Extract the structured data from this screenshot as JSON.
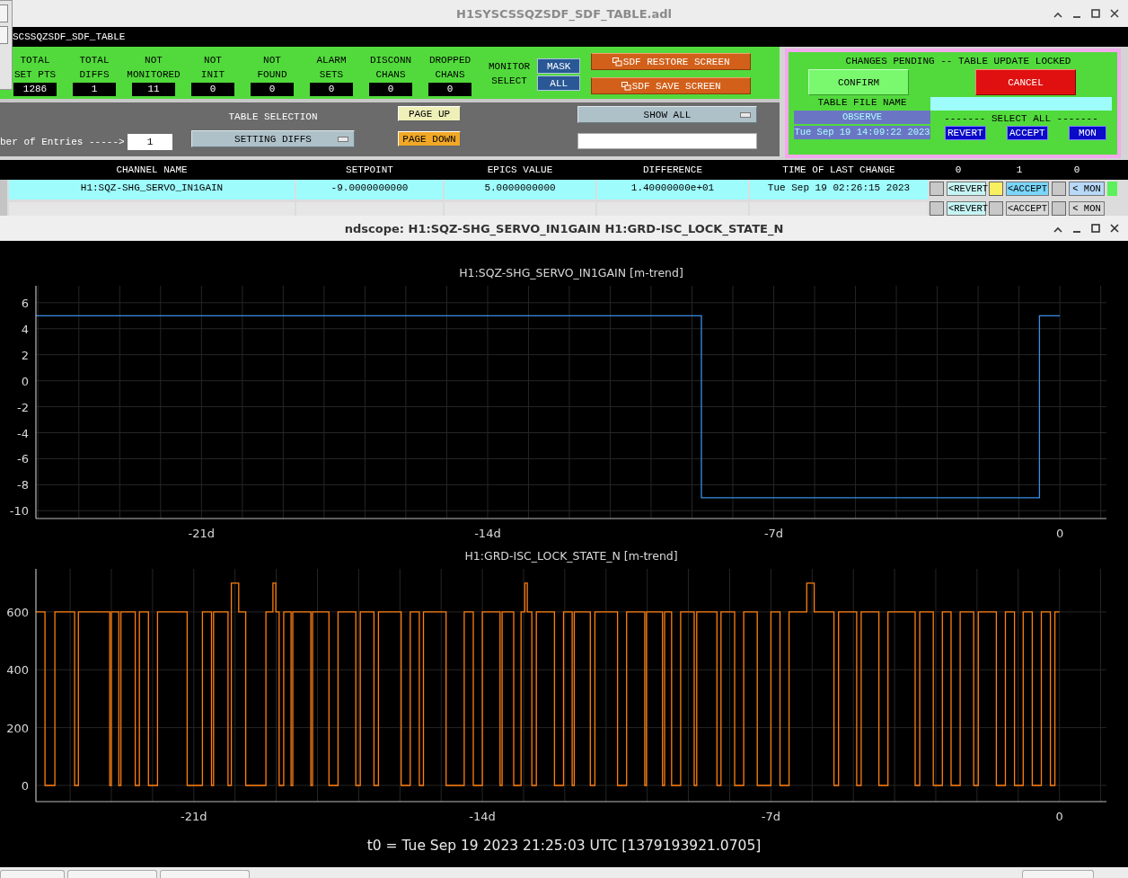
{
  "sdf_window": {
    "title": "H1SYSCSSQZSDF_SDF_TABLE.adl",
    "header": "SCSSQZSDF_SDF_TABLE",
    "counters": [
      {
        "label_lines": [
          "TOTAL",
          "SET PTS"
        ],
        "value": "1286"
      },
      {
        "label_lines": [
          "TOTAL",
          "DIFFS"
        ],
        "value": "1"
      },
      {
        "label_lines": [
          "NOT",
          "MONITORED"
        ],
        "value": "11"
      },
      {
        "label_lines": [
          "NOT",
          "INIT"
        ],
        "value": "0"
      },
      {
        "label_lines": [
          "NOT",
          "FOUND"
        ],
        "value": "0"
      },
      {
        "label_lines": [
          "ALARM",
          "SETS"
        ],
        "value": "0"
      },
      {
        "label_lines": [
          "DISCONN",
          "CHANS"
        ],
        "value": "0"
      },
      {
        "label_lines": [
          "DROPPED",
          "CHANS"
        ],
        "value": "0"
      }
    ],
    "monitor_select": {
      "label_lines": [
        "MONITOR",
        "SELECT"
      ],
      "buttons": [
        "MASK",
        "ALL"
      ]
    },
    "screen_buttons": [
      "SDF RESTORE SCREEN",
      "SDF SAVE SCREEN"
    ],
    "entries": {
      "label": "ber of Entries ----->",
      "value": "1"
    },
    "table_selection": {
      "label": "TABLE SELECTION",
      "value": "SETTING DIFFS"
    },
    "page_buttons": [
      {
        "label": "PAGE UP",
        "kind": "up"
      },
      {
        "label": "PAGE DOWN",
        "kind": "down"
      }
    ],
    "show_menu": {
      "value": "SHOW ALL"
    },
    "pending_panel": {
      "message": "CHANGES PENDING -- TABLE UPDATE LOCKED",
      "confirm": "CONFIRM",
      "cancel": "CANCEL",
      "file_label": "TABLE FILE NAME",
      "mode": "OBSERVE",
      "timestamp": "Tue Sep 19 14:09:22 2023",
      "select_all": "------- SELECT ALL -------",
      "select_buttons": [
        "REVERT",
        "ACCEPT",
        "MON"
      ]
    },
    "table": {
      "columns": [
        "CHANNEL NAME",
        "SETPOINT",
        "EPICS VALUE",
        "DIFFERENCE",
        "TIME OF LAST CHANGE"
      ],
      "check_headers": [
        "0",
        "1",
        "0"
      ],
      "rows": [
        {
          "cells": [
            "H1:SQZ-SHG_SERVO_IN1GAIN",
            "-9.0000000000",
            "5.0000000000",
            "1.40000000e+01",
            "Tue Sep 19 02:26:15 2023"
          ],
          "active": true,
          "checks": [
            false,
            true,
            false
          ],
          "actions": [
            "<REVERT",
            "<ACCEPT",
            "< MON"
          ],
          "flag": true
        },
        {
          "active": false,
          "checks": [
            false,
            false,
            false
          ],
          "actions": [
            "<REVERT",
            "<ACCEPT",
            "< MON"
          ],
          "flag": false
        }
      ]
    }
  },
  "ndscope": {
    "title": "ndscope: H1:SQZ-SHG_SERVO_IN1GAIN H1:GRD-ISC_LOCK_STATE_N",
    "plots": [
      {
        "chart_data": {
          "type": "line",
          "title": "H1:SQZ-SHG_SERVO_IN1GAIN [m-trend]",
          "x": [
            -25.05,
            -8.77,
            -8.77,
            -0.5,
            -0.5,
            0
          ],
          "series": [
            {
              "color": "#3a8ee6",
              "values": [
                5,
                5,
                -9,
                -9,
                5,
                5
              ]
            }
          ],
          "xlim": [
            -25.05,
            1.14
          ],
          "ylim": [
            -10.6,
            7.3
          ],
          "grid": true,
          "xticks": [
            {
              "value": -21,
              "label": "-21d"
            },
            {
              "value": -14,
              "label": "-14d"
            },
            {
              "value": -7,
              "label": "-7d"
            },
            {
              "value": 0,
              "label": "0"
            }
          ],
          "yticks": [
            -10,
            -8,
            -6,
            -4,
            -2,
            0,
            2,
            4,
            6
          ]
        }
      },
      {
        "chart_data": {
          "type": "line",
          "title": "H1:GRD-ISC_LOCK_STATE_N [m-trend]",
          "x": [
            -24.83,
            -24.61,
            -24.61,
            -24.37,
            -24.37,
            -23.89,
            -23.89,
            -23.8,
            -23.8,
            -23.04,
            -23.04,
            -23.0,
            -23.0,
            -22.82,
            -22.82,
            -22.77,
            -22.77,
            -22.42,
            -22.42,
            -22.32,
            -22.32,
            -22.1,
            -22.1,
            -21.88,
            -21.88,
            -21.16,
            -21.16,
            -20.79,
            -20.79,
            -20.57,
            -20.57,
            -20.52,
            -20.52,
            -20.17,
            -20.17,
            -20.09,
            -20.09,
            -19.91,
            -19.91,
            -19.74,
            -19.74,
            -19.25,
            -19.25,
            -19.08,
            -19.08,
            -19.01,
            -19.01,
            -18.93,
            -18.93,
            -18.82,
            -18.82,
            -18.64,
            -18.64,
            -18.6,
            -18.6,
            -18.16,
            -18.16,
            -18.12,
            -18.12,
            -17.72,
            -17.72,
            -17.5,
            -17.5,
            -17.07,
            -17.07,
            -16.96,
            -16.96,
            -16.63,
            -16.63,
            -16.52,
            -16.52,
            -15.97,
            -15.97,
            -15.75,
            -15.75,
            -15.53,
            -15.53,
            -15.43,
            -15.43,
            -14.88,
            -14.88,
            -14.44,
            -14.44,
            -14.22,
            -14.22,
            -14.0,
            -14.0,
            -13.57,
            -13.57,
            -13.52,
            -13.52,
            -13.24,
            -13.24,
            -13.06,
            -13.06,
            -12.97,
            -12.97,
            -12.91,
            -12.91,
            -12.8,
            -12.8,
            -12.69,
            -12.69,
            -12.25,
            -12.25,
            -12.03,
            -12.03,
            -11.82,
            -11.82,
            -11.77,
            -11.77,
            -11.38,
            -11.38,
            -11.27,
            -11.27,
            -10.72,
            -10.72,
            -10.5,
            -10.5,
            -10.06,
            -10.06,
            -10.02,
            -10.02,
            -9.63,
            -9.63,
            -9.58,
            -9.58,
            -9.41,
            -9.41,
            -9.19,
            -9.19,
            -8.86,
            -8.86,
            -8.8,
            -8.8,
            -8.31,
            -8.31,
            -8.21,
            -8.21,
            -7.88,
            -7.88,
            -7.66,
            -7.66,
            -7.33,
            -7.33,
            -7.0,
            -7.0,
            -6.78,
            -6.78,
            -6.56,
            -6.56,
            -6.13,
            -6.13,
            -5.95,
            -5.95,
            -5.47,
            -5.47,
            -5.36,
            -5.36,
            -4.92,
            -4.92,
            -4.81,
            -4.81,
            -4.38,
            -4.38,
            -4.16,
            -4.16,
            -3.5,
            -3.5,
            -3.39,
            -3.39,
            -3.06,
            -3.06,
            -2.84,
            -2.84,
            -2.63,
            -2.63,
            -2.41,
            -2.41,
            -2.08,
            -2.08,
            -1.97,
            -1.97,
            -1.53,
            -1.53,
            -1.31,
            -1.31,
            -1.09,
            -1.09,
            -0.88,
            -0.88,
            -0.66,
            -0.66,
            -0.44,
            -0.44,
            -0.22,
            -0.22,
            -0.11,
            -0.11,
            0
          ],
          "series": [
            {
              "color": "#ff7f0e",
              "values": [
                600,
                600,
                0,
                0,
                600,
                600,
                0,
                0,
                600,
                600,
                0,
                0,
                600,
                600,
                0,
                0,
                600,
                600,
                0,
                0,
                600,
                600,
                0,
                0,
                600,
                600,
                0,
                0,
                600,
                600,
                0,
                0,
                600,
                600,
                0,
                0,
                700,
                700,
                600,
                600,
                0,
                0,
                600,
                600,
                700,
                700,
                600,
                600,
                0,
                0,
                600,
                600,
                0,
                0,
                600,
                600,
                0,
                0,
                600,
                600,
                0,
                0,
                600,
                600,
                0,
                0,
                600,
                600,
                0,
                0,
                600,
                600,
                0,
                0,
                600,
                600,
                0,
                0,
                600,
                600,
                0,
                0,
                600,
                600,
                0,
                0,
                600,
                600,
                0,
                0,
                600,
                600,
                0,
                0,
                600,
                600,
                700,
                700,
                600,
                600,
                0,
                0,
                600,
                600,
                0,
                0,
                600,
                600,
                0,
                0,
                600,
                600,
                0,
                0,
                600,
                600,
                0,
                0,
                600,
                600,
                0,
                0,
                600,
                600,
                0,
                0,
                600,
                600,
                0,
                0,
                600,
                600,
                0,
                0,
                600,
                600,
                0,
                0,
                600,
                600,
                0,
                0,
                600,
                600,
                0,
                0,
                600,
                600,
                0,
                0,
                600,
                600,
                700,
                700,
                600,
                600,
                0,
                0,
                600,
                600,
                0,
                0,
                600,
                600,
                0,
                0,
                600,
                600,
                0,
                0,
                600,
                600,
                0,
                0,
                600,
                600,
                0,
                0,
                600,
                600,
                0,
                0,
                600,
                600,
                0,
                0,
                600,
                600,
                0,
                0,
                600,
                600,
                0,
                0,
                600,
                600,
                0,
                0,
                600,
                600
              ]
            }
          ],
          "xlim": [
            -24.83,
            1.14
          ],
          "ylim": [
            -56,
            749
          ],
          "grid": true,
          "xticks": [
            {
              "value": -21,
              "label": "-21d"
            },
            {
              "value": -14,
              "label": "-14d"
            },
            {
              "value": -7,
              "label": "-7d"
            },
            {
              "value": 0,
              "label": "0"
            }
          ],
          "yticks": [
            0,
            200,
            400,
            600
          ]
        }
      }
    ],
    "t0": "t0 = Tue Sep 19 2023 21:25:03 UTC [1379193921.0705]"
  }
}
